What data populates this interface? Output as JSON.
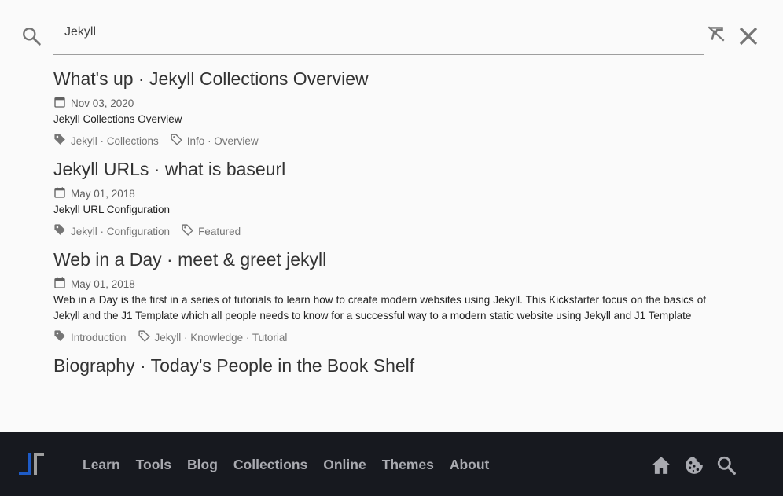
{
  "search": {
    "value": "Jekyll",
    "placeholder": "Search"
  },
  "results": [
    {
      "title": "What's up · Jekyll Collections Overview",
      "date": "Nov 03, 2020",
      "description": "Jekyll Collections Overview",
      "categories": "Jekyll · Collections",
      "tags": "Info · Overview"
    },
    {
      "title": "Jekyll URLs · what is baseurl",
      "date": "May 01, 2018",
      "description": "Jekyll URL Configuration",
      "categories": "Jekyll · Configuration",
      "tags": "Featured"
    },
    {
      "title": "Web in a Day · meet & greet jekyll",
      "date": "May 01, 2018",
      "description": "Web in a Day is the first in a series of tutorials to learn how to create modern websites using Jekyll. This Kickstarter focus on the basics of Jekyll and the J1 Template which all people needs to know for a successful way to a modern static website using Jekyll and J1 Template",
      "categories": "Introduction",
      "tags": "Jekyll · Knowledge · Tutorial"
    },
    {
      "title": "Biography · Today's People in the Book Shelf"
    }
  ],
  "navbar": {
    "links": [
      "Learn",
      "Tools",
      "Blog",
      "Collections",
      "Online",
      "Themes",
      "About"
    ],
    "icons": [
      "home-icon",
      "cookie-icon",
      "search-icon"
    ]
  },
  "colors": {
    "background": "#fafafa",
    "navbar": "#17191f",
    "nav_text": "#a9aab0",
    "logo_blue": "#1e5bc6",
    "logo_gray": "#9e9e9e"
  }
}
